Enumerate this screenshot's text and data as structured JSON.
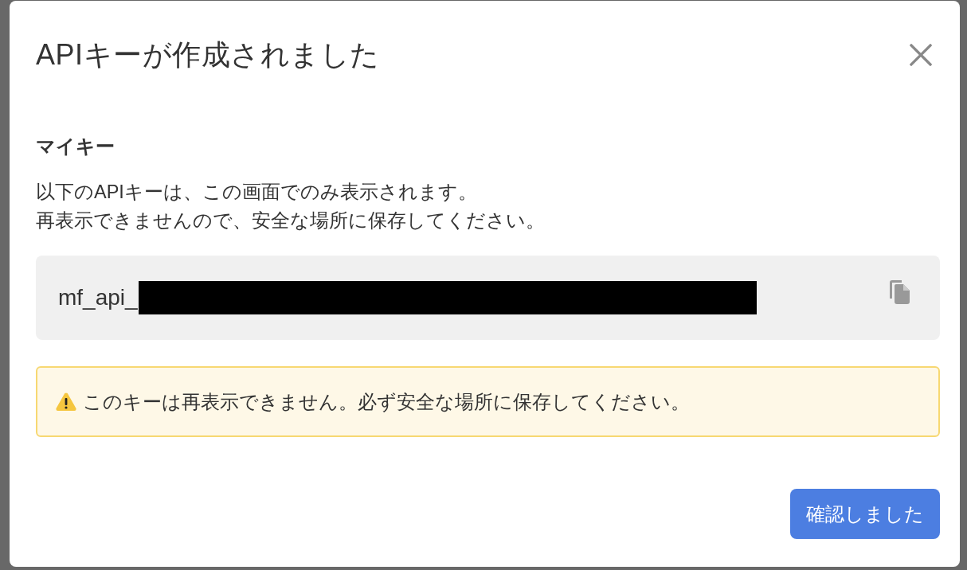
{
  "dialog": {
    "title": "APIキーが作成されました",
    "section_title": "マイキー",
    "description": [
      "以下のAPIキーは、この画面でのみ表示されます。",
      "再表示できませんので、安全な場所に保存してください。"
    ],
    "api_key": {
      "value": "mf_api_",
      "redacted": true
    },
    "warning": {
      "text": "このキーは再表示できません。必ず安全な場所に保存してください。"
    },
    "buttons": [
      {
        "label": "確認しました",
        "kind": "primary"
      }
    ]
  }
}
